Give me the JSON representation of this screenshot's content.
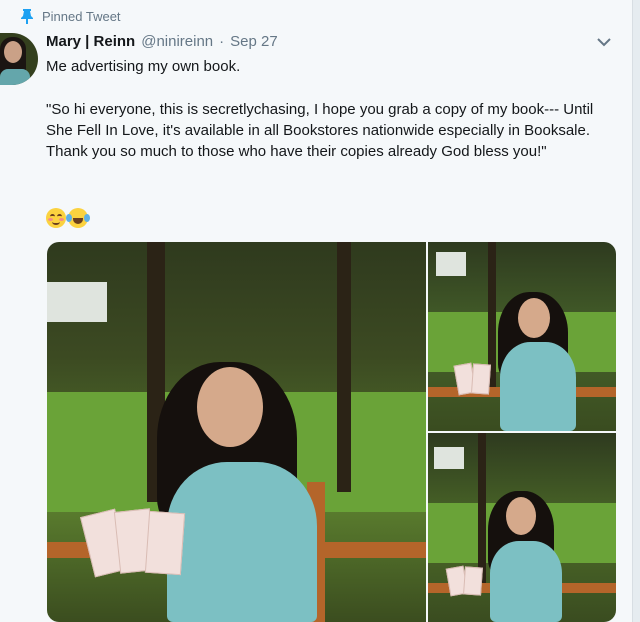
{
  "pinned": {
    "label": "Pinned Tweet",
    "icon": "pin-icon"
  },
  "tweet": {
    "author_name": "Mary | Reinn",
    "handle": "@ninireinn",
    "separator": "·",
    "date": "Sep 27",
    "line1": "Me advertising my own book.",
    "body": "\"So hi everyone, this is secretlychasing, I hope you grab a copy of my book--- Until She Fell In Love, it's available in all Bookstores nationwide especially in Booksale. Thank you so much to those who have their copies already God bless you!\"",
    "emojis": [
      "smiling-face-emoji",
      "tears-of-joy-emoji"
    ]
  },
  "colors": {
    "accent": "#1da1f2",
    "text": "#14171a",
    "muted": "#657786"
  }
}
